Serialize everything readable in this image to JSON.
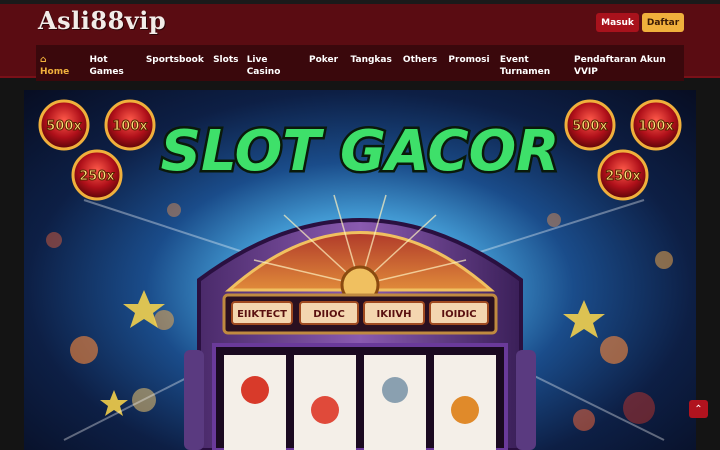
{
  "header": {
    "logo_text": "Asli88vip",
    "login_label": "Masuk",
    "register_label": "Daftar"
  },
  "nav": {
    "items": [
      {
        "label": "Home",
        "icon": "home-icon",
        "active": true
      },
      {
        "label": "Hot Games"
      },
      {
        "label": "Sportsbook"
      },
      {
        "label": "Slots"
      },
      {
        "label": "Live Casino"
      },
      {
        "label": "Poker"
      },
      {
        "label": "Tangkas"
      },
      {
        "label": "Others"
      },
      {
        "label": "Promosi"
      },
      {
        "label": "Event Turnamen"
      },
      {
        "label": "Pendaftaran Akun VVIP"
      }
    ]
  },
  "hero": {
    "title": "SLOT GACOR",
    "badges_left": [
      "500x",
      "100x",
      "250x"
    ],
    "badges_right": [
      "500x",
      "100x",
      "250x"
    ],
    "reel_words": [
      "EIIKTECT",
      "DIIOC",
      "IKIIVH",
      "IOIDIC"
    ]
  },
  "colors": {
    "header_bg": "#5a0c12",
    "nav_bg": "#3a080c",
    "accent_gold": "#f0b03c",
    "login_red": "#a8121c",
    "title_green": "#3ee06a"
  },
  "scroll_top_icon": "chevron-up-icon"
}
